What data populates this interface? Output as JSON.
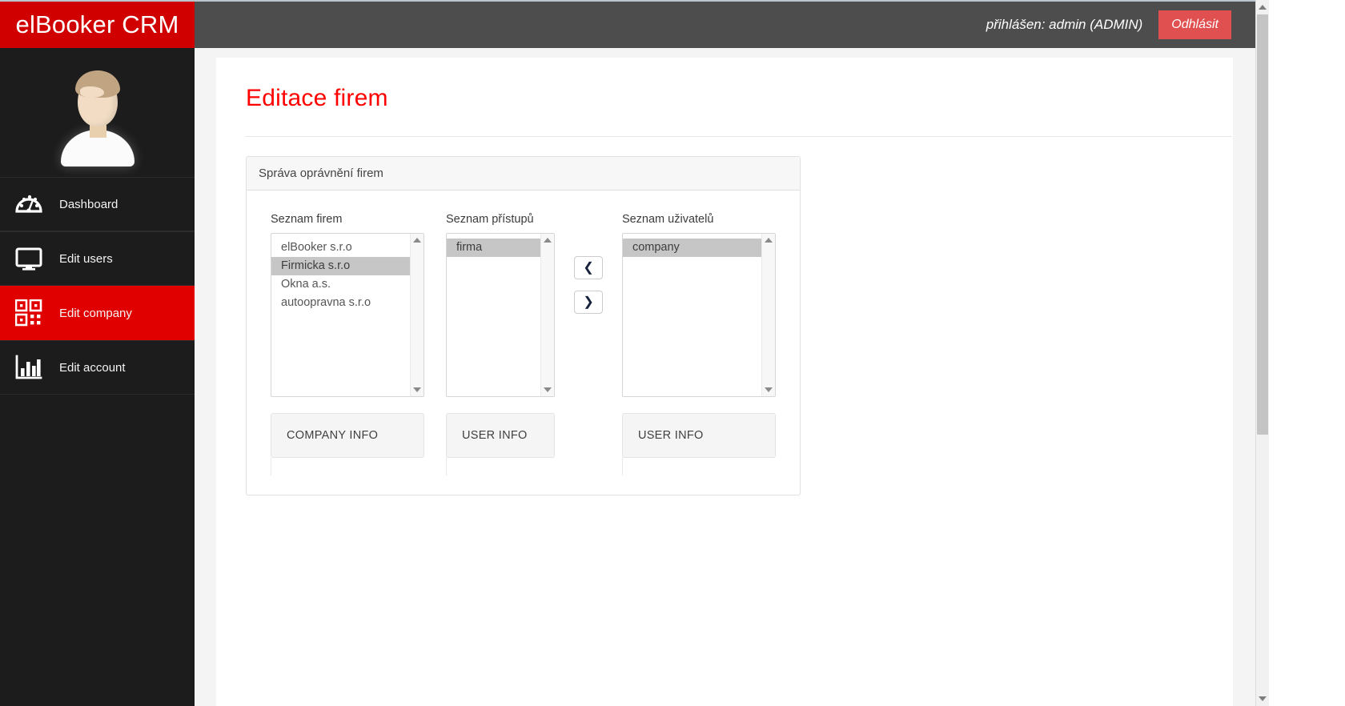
{
  "brand": {
    "title": "elBooker CRM"
  },
  "topbar": {
    "login_text": "přihlášen: admin (ADMIN)",
    "logout_label": "Odhlásit",
    "accent_red": "#d10000",
    "bar_gray": "#4d4d4d",
    "logout_color": "#e05050"
  },
  "sidebar": {
    "avatar_alt": "user-avatar",
    "items": [
      {
        "id": "dashboard",
        "label": "Dashboard",
        "icon": "dashboard-gauge-icon",
        "active": false
      },
      {
        "id": "edit-users",
        "label": "Edit users",
        "icon": "monitor-icon",
        "active": false
      },
      {
        "id": "edit-company",
        "label": "Edit company",
        "icon": "qr-code-icon",
        "active": true
      },
      {
        "id": "edit-account",
        "label": "Edit account",
        "icon": "bar-chart-icon",
        "active": false
      }
    ],
    "active_color": "#e00000"
  },
  "page": {
    "title": "Editace firem",
    "title_color": "#ff0000"
  },
  "panel": {
    "header": "Správa oprávnění firem",
    "columns": {
      "companies": {
        "label": "Seznam firem",
        "items": [
          {
            "text": "elBooker s.r.o",
            "selected": false
          },
          {
            "text": "Firmicka s.r.o",
            "selected": true
          },
          {
            "text": "Okna a.s.",
            "selected": false
          },
          {
            "text": "autoopravna s.r.o",
            "selected": false
          }
        ],
        "info_label": "COMPANY INFO"
      },
      "permissions": {
        "label": "Seznam přístupů",
        "items": [
          {
            "text": "firma",
            "selected": true
          }
        ],
        "info_label": "USER INFO"
      },
      "users": {
        "label": "Seznam uživatelů",
        "items": [
          {
            "text": "company",
            "selected": true
          }
        ],
        "info_label": "USER INFO"
      }
    },
    "buttons": {
      "move_left": "❮",
      "move_right": "❯"
    },
    "selection_color": "#c6c6c6"
  }
}
